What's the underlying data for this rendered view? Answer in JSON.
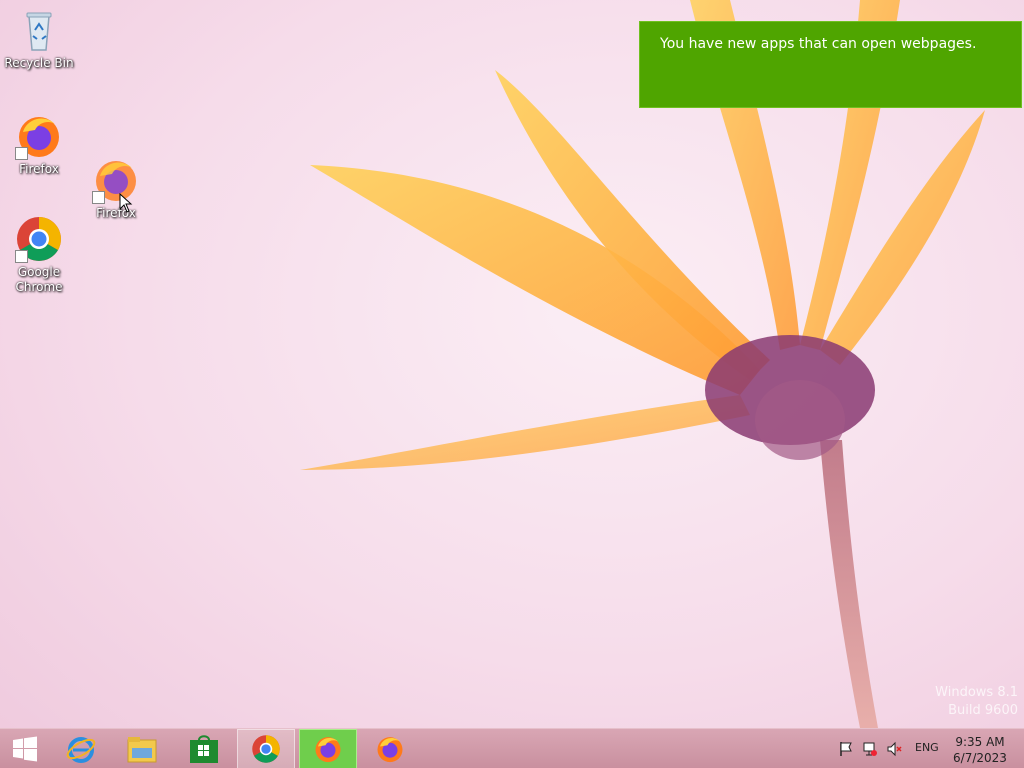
{
  "desktop": {
    "icons": [
      {
        "label": "Recycle Bin"
      },
      {
        "label": "Firefox"
      },
      {
        "label": "Firefox"
      },
      {
        "label": "Google Chrome"
      }
    ]
  },
  "toast": {
    "message": "You have new apps that can open webpages."
  },
  "watermark": {
    "line1": "Windows 8.1",
    "line2": "Build 9600"
  },
  "taskbar": {
    "pinned": [
      "start-button",
      "internet-explorer",
      "file-explorer",
      "store",
      "google-chrome",
      "firefox",
      "firefox"
    ],
    "tray": {
      "language": "ENG",
      "time": "9:35 AM",
      "date": "6/7/2023"
    }
  },
  "colors": {
    "toast_bg": "#4fa500",
    "taskbar_bg": "#d9a6b4",
    "focused_task": "#6fce4c"
  }
}
